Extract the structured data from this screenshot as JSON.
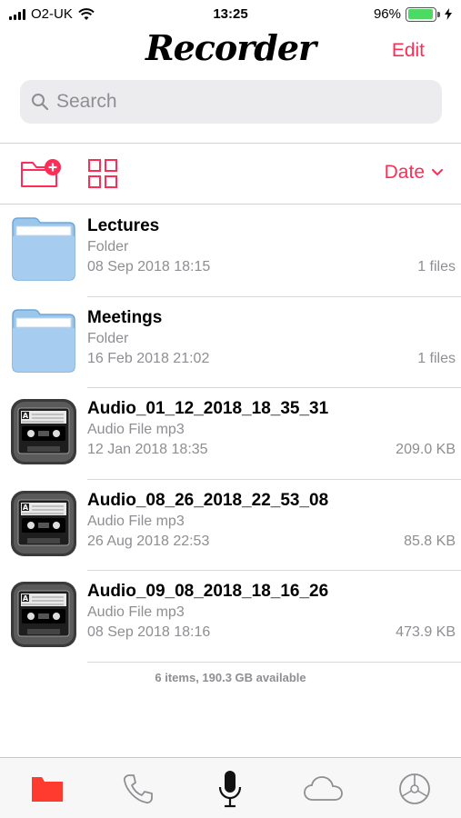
{
  "status_bar": {
    "carrier": "O2-UK",
    "time": "13:25",
    "battery_percent": "96%",
    "battery_level": 0.96
  },
  "header": {
    "title": "Recorder",
    "edit_label": "Edit"
  },
  "search": {
    "placeholder": "Search"
  },
  "toolbar": {
    "sort_label": "Date"
  },
  "items": [
    {
      "kind": "folder",
      "name": "Lectures",
      "type": "Folder",
      "date": "08 Sep 2018 18:15",
      "size": "1 files"
    },
    {
      "kind": "folder",
      "name": "Meetings",
      "type": "Folder",
      "date": "16 Feb 2018 21:02",
      "size": "1 files"
    },
    {
      "kind": "audio",
      "name": "Audio_01_12_2018_18_35_31",
      "type": "Audio File mp3",
      "date": "12 Jan 2018 18:35",
      "size": "209.0 KB"
    },
    {
      "kind": "audio",
      "name": "Audio_08_26_2018_22_53_08",
      "type": "Audio File mp3",
      "date": "26 Aug 2018 22:53",
      "size": "85.8 KB"
    },
    {
      "kind": "audio",
      "name": "Audio_09_08_2018_18_16_26",
      "type": "Audio File mp3",
      "date": "08 Sep 2018 18:16",
      "size": "473.9 KB"
    }
  ],
  "summary": "6 items, 190.3 GB available",
  "tabs": [
    "files",
    "calls",
    "record",
    "cloud",
    "settings"
  ],
  "colors": {
    "accent": "#ff2d55",
    "tab_active": "#ff3b30",
    "folder": "#9cc7ec",
    "battery": "#4cd964"
  }
}
